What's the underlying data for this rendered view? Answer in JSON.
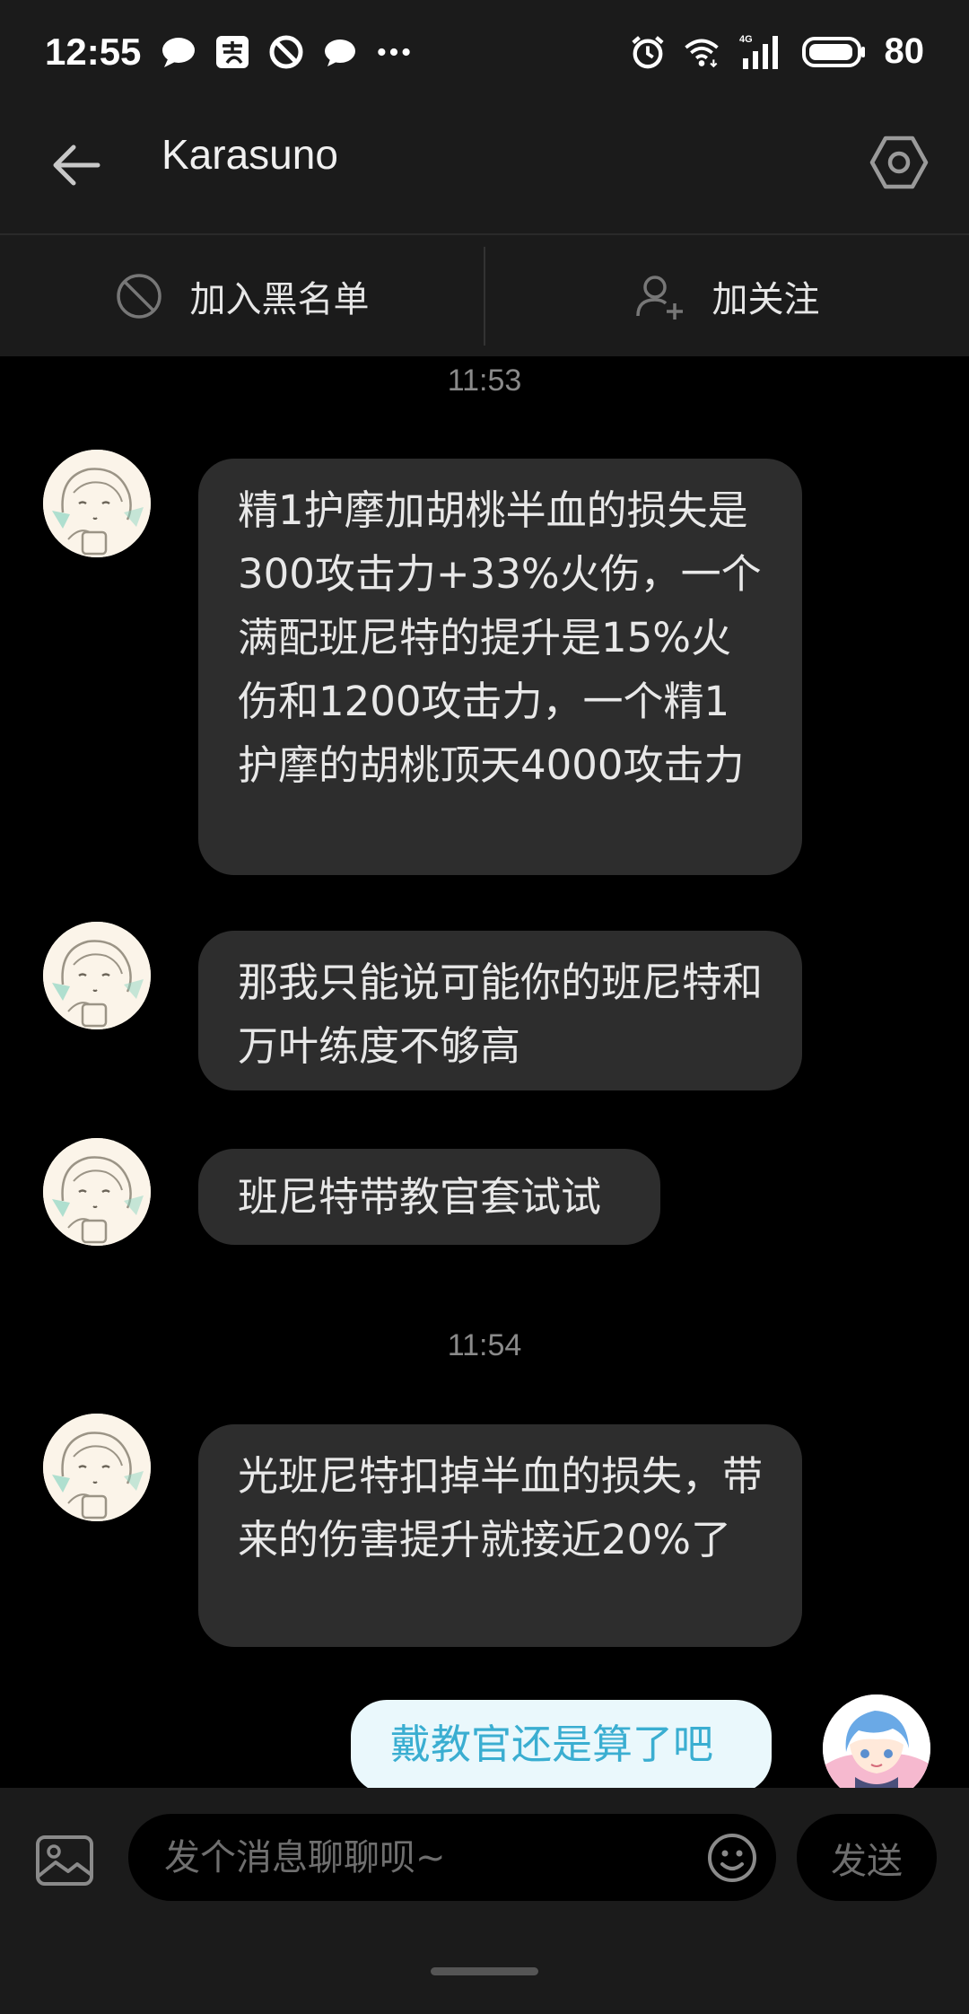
{
  "status_bar": {
    "time": "12:55",
    "notifications": [
      "chat-bubble-icon",
      "alipay-icon",
      "do-not-disturb-icon",
      "message-icon",
      "more-dots-icon"
    ],
    "network": "4G",
    "battery": "80"
  },
  "header": {
    "title": "Karasuno"
  },
  "actions": {
    "blacklist_label": "加入黑名单",
    "follow_label": "加关注"
  },
  "messages": {
    "ts1": "11:53",
    "m1": "精1护摩加胡桃半血的损失是300攻击力+33%火伤，一个满配班尼特的提升是15%火伤和1200攻击力，一个精1护摩的胡桃顶天4000攻击力",
    "m2": "那我只能说可能你的班尼特和万叶练度不够高",
    "m3": "班尼特带教官套试试",
    "ts2": "11:54",
    "m4": "光班尼特扣掉半血的损失，带来的伤害提升就接近20%了",
    "m5": "戴教官还是算了吧"
  },
  "input": {
    "placeholder": "发个消息聊聊呗~",
    "send_label": "发送"
  },
  "colors": {
    "bar_bg": "#1b1b1b",
    "bubble_other": "#2d2d2d",
    "bubble_self": "#eaf8fc",
    "self_text": "#3aaed1"
  }
}
